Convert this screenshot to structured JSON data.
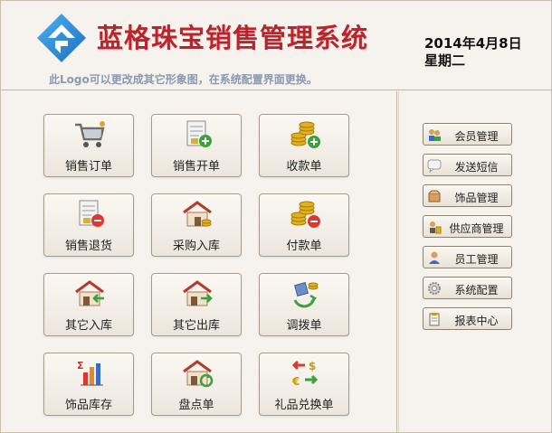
{
  "header": {
    "title": "蓝格珠宝销售管理系统",
    "tagline": "此Logo可以更改成其它形象图，在系统配置界面更换。",
    "date": "2014年4月8日",
    "weekday": "星期二"
  },
  "tiles": [
    {
      "label": "销售订单",
      "icon": "shopping-cart-icon"
    },
    {
      "label": "销售开单",
      "icon": "invoice-add-icon"
    },
    {
      "label": "收款单",
      "icon": "coins-add-icon"
    },
    {
      "label": "销售退货",
      "icon": "invoice-return-icon"
    },
    {
      "label": "采购入库",
      "icon": "warehouse-in-icon"
    },
    {
      "label": "付款单",
      "icon": "coins-remove-icon"
    },
    {
      "label": "其它入库",
      "icon": "house-in-icon"
    },
    {
      "label": "其它出库",
      "icon": "house-out-icon"
    },
    {
      "label": "调拨单",
      "icon": "transfer-icon"
    },
    {
      "label": "饰品库存",
      "icon": "bar-chart-icon"
    },
    {
      "label": "盘点单",
      "icon": "house-refresh-icon"
    },
    {
      "label": "礼品兑换单",
      "icon": "currency-exchange-icon"
    }
  ],
  "sidebar": [
    {
      "label": "会员管理",
      "icon": "members-icon"
    },
    {
      "label": "发送短信",
      "icon": "message-icon"
    },
    {
      "label": "饰品管理",
      "icon": "box-icon"
    },
    {
      "label": "供应商管理",
      "icon": "supplier-icon"
    },
    {
      "label": "员工管理",
      "icon": "employee-icon"
    },
    {
      "label": "系统配置",
      "icon": "settings-icon"
    },
    {
      "label": "报表中心",
      "icon": "report-icon"
    }
  ],
  "colors": {
    "title": "#b8262c",
    "tagline": "#8a9ab0",
    "logo": "#2a87d6",
    "background": "#f4f0ea"
  }
}
